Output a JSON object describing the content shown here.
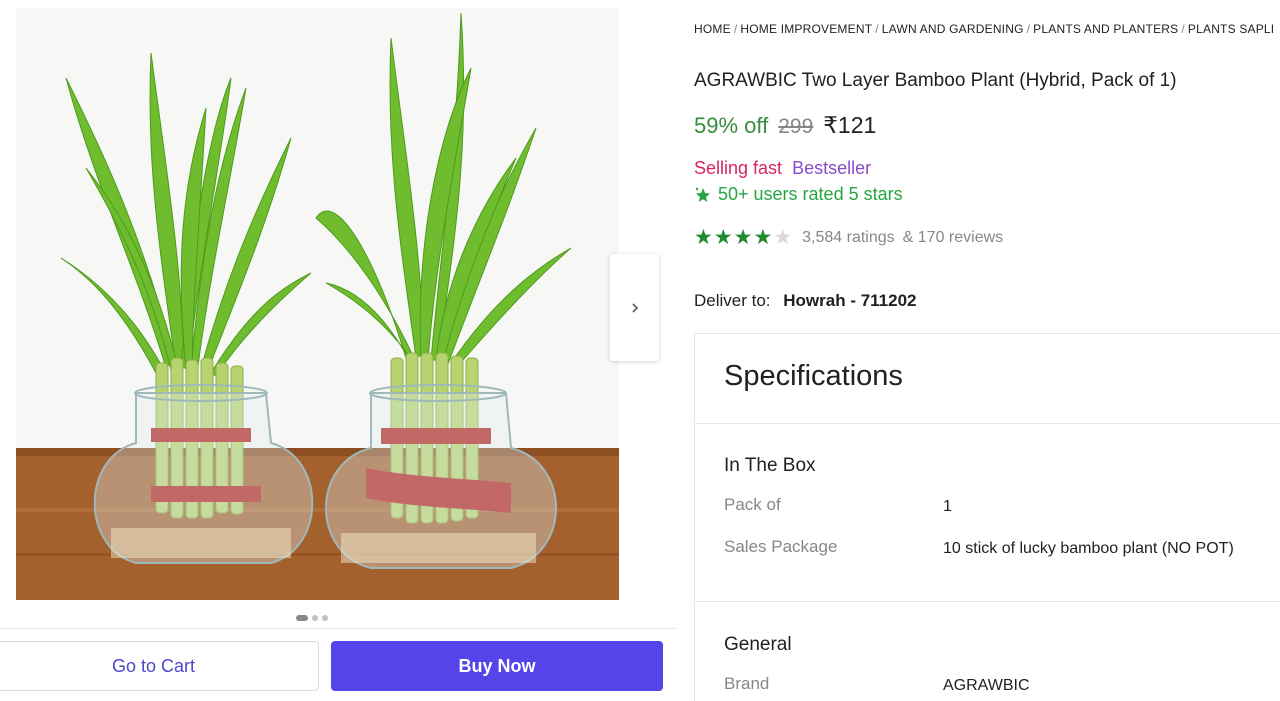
{
  "gallery": {
    "image_alt": "Two glass bowls with two-layer lucky bamboo plants tied with red ribbon",
    "dots_count": 3,
    "active_dot": 0,
    "next_icon": "chevron-right-icon"
  },
  "actions": {
    "cart_label": "Go to Cart",
    "buy_label": "Buy Now"
  },
  "breadcrumb": [
    "HOME",
    "HOME IMPROVEMENT",
    "LAWN AND GARDENING",
    "PLANTS AND PLANTERS",
    "PLANTS SAPLI"
  ],
  "product": {
    "title": "AGRAWBIC Two Layer Bamboo Plant (Hybrid, Pack of 1)",
    "discount": "59% off",
    "mrp": "299",
    "price": "₹121",
    "tag_selling": "Selling fast",
    "tag_best": "Bestseller",
    "rated_text": "50+ users rated 5 stars",
    "star_rating": 4,
    "star_max": 5,
    "ratings": "3,584 ratings",
    "reviews": "& 170 reviews"
  },
  "delivery": {
    "label": "Deliver to:",
    "location": "Howrah - 711202"
  },
  "specifications": {
    "title": "Specifications",
    "sections": [
      {
        "title": "In The Box",
        "rows": [
          {
            "key": "Pack of",
            "value": "1"
          },
          {
            "key": "Sales Package",
            "value": "10 stick of lucky bamboo plant (NO POT)"
          }
        ]
      },
      {
        "title": "General",
        "rows": [
          {
            "key": "Brand",
            "value": "AGRAWBIC"
          }
        ]
      }
    ]
  },
  "colors": {
    "discount_green": "#388e3c",
    "buy_button": "#5444ea",
    "cart_text": "#4f46c8",
    "selling_fast": "#d6265b",
    "bestseller": "#8a4bc4",
    "rated_green": "#26a541",
    "star_green": "#1f8a2e"
  }
}
